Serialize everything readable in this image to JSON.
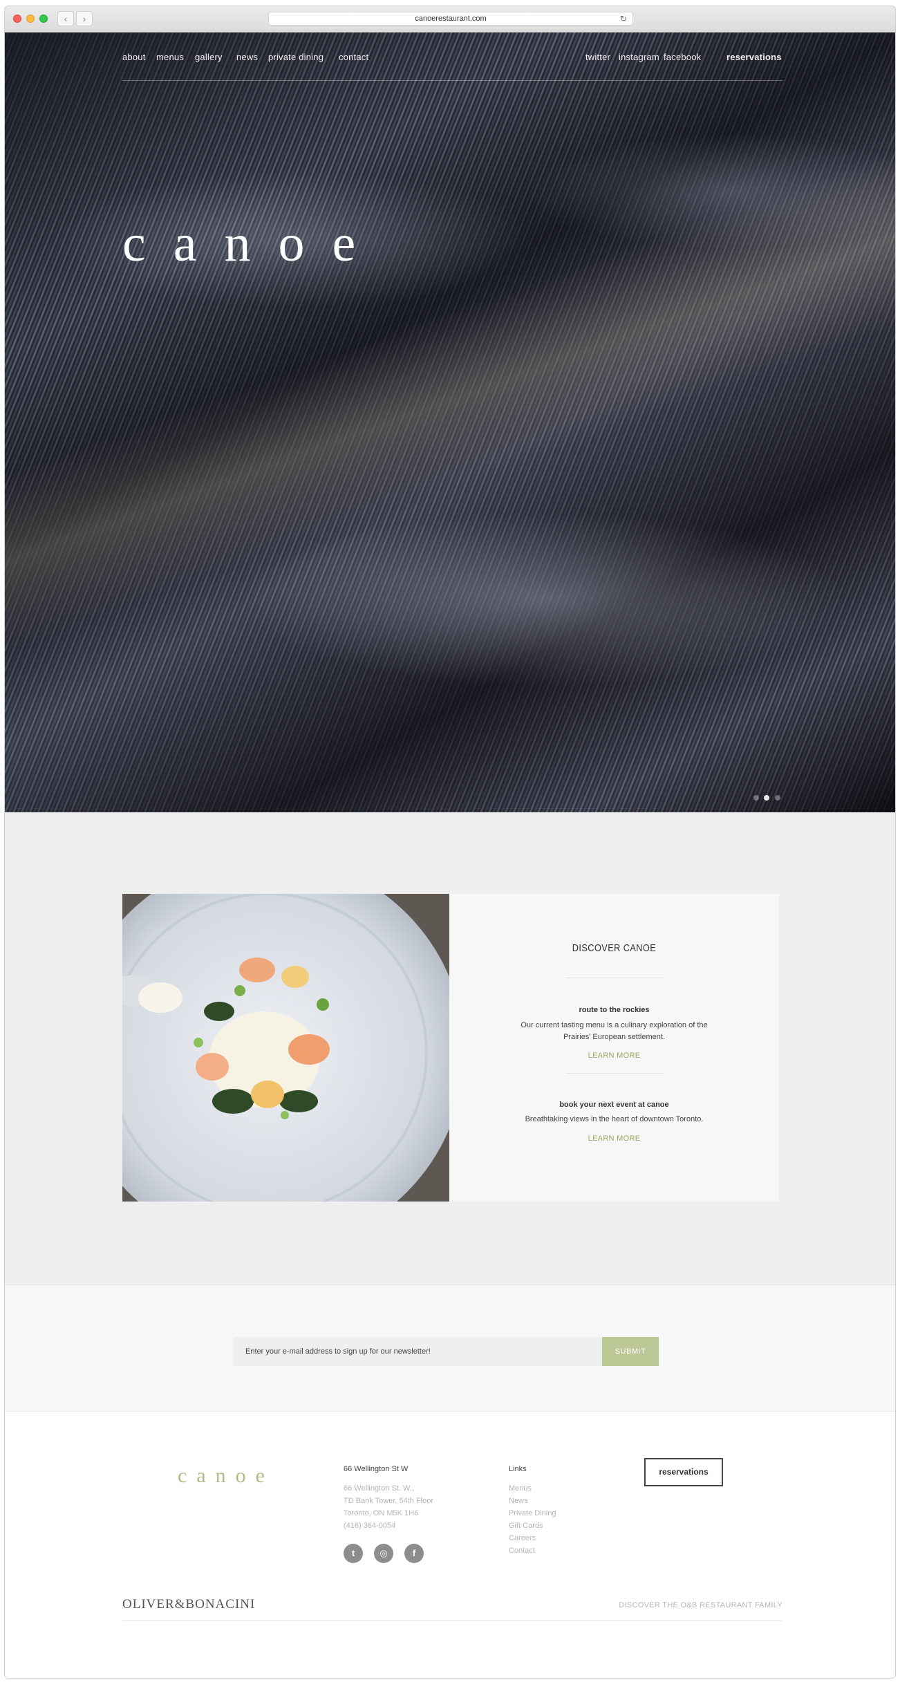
{
  "browser": {
    "url": "canoerestaurant.com",
    "back_glyph": "‹",
    "forward_glyph": "›",
    "reload_glyph": "↻"
  },
  "hero": {
    "nav": [
      "about",
      "menus",
      "gallery",
      "news",
      "private dining",
      "contact"
    ],
    "social": [
      "twitter",
      "instagram",
      "facebook"
    ],
    "reservations_label": "reservations",
    "logo": "canoe",
    "slides_count": 3,
    "active_slide": 2
  },
  "discover": {
    "title": "DISCOVER CANOE",
    "items": [
      {
        "title": "route to the rockies",
        "description": "Our current tasting menu is a culinary exploration of the Prairies' European settlement.",
        "link": "LEARN MORE"
      },
      {
        "title": "book your next event at canoe",
        "description": "Breathtaking views in the heart of downtown Toronto.",
        "link": "LEARN MORE"
      }
    ]
  },
  "newsletter": {
    "placeholder": "Enter your e-mail address to sign up for our newsletter!",
    "submit_label": "SUBMIT"
  },
  "footer": {
    "logo": "canoe",
    "address_title": "66 Wellington St W",
    "address_lines": [
      "66 Wellington St. W.,",
      "TD Bank Tower, 54th Floor",
      "Toronto, ON M5K 1H6",
      "(416) 364-0054"
    ],
    "social_icons": [
      "twitter-icon",
      "instagram-icon",
      "facebook-icon"
    ],
    "links_title": "Links",
    "links": [
      "Menus",
      "News",
      "Private Dining",
      "Gift Cards",
      "Careers",
      "Contact"
    ],
    "reservations_label": "reservations",
    "brand": "OLIVER&BONACINI",
    "family_link": "DISCOVER THE O&B RESTAURANT FAMILY"
  },
  "colors": {
    "accent_green": "#bcc796",
    "link_green": "#9aa85f",
    "section_grey": "#efefef"
  }
}
